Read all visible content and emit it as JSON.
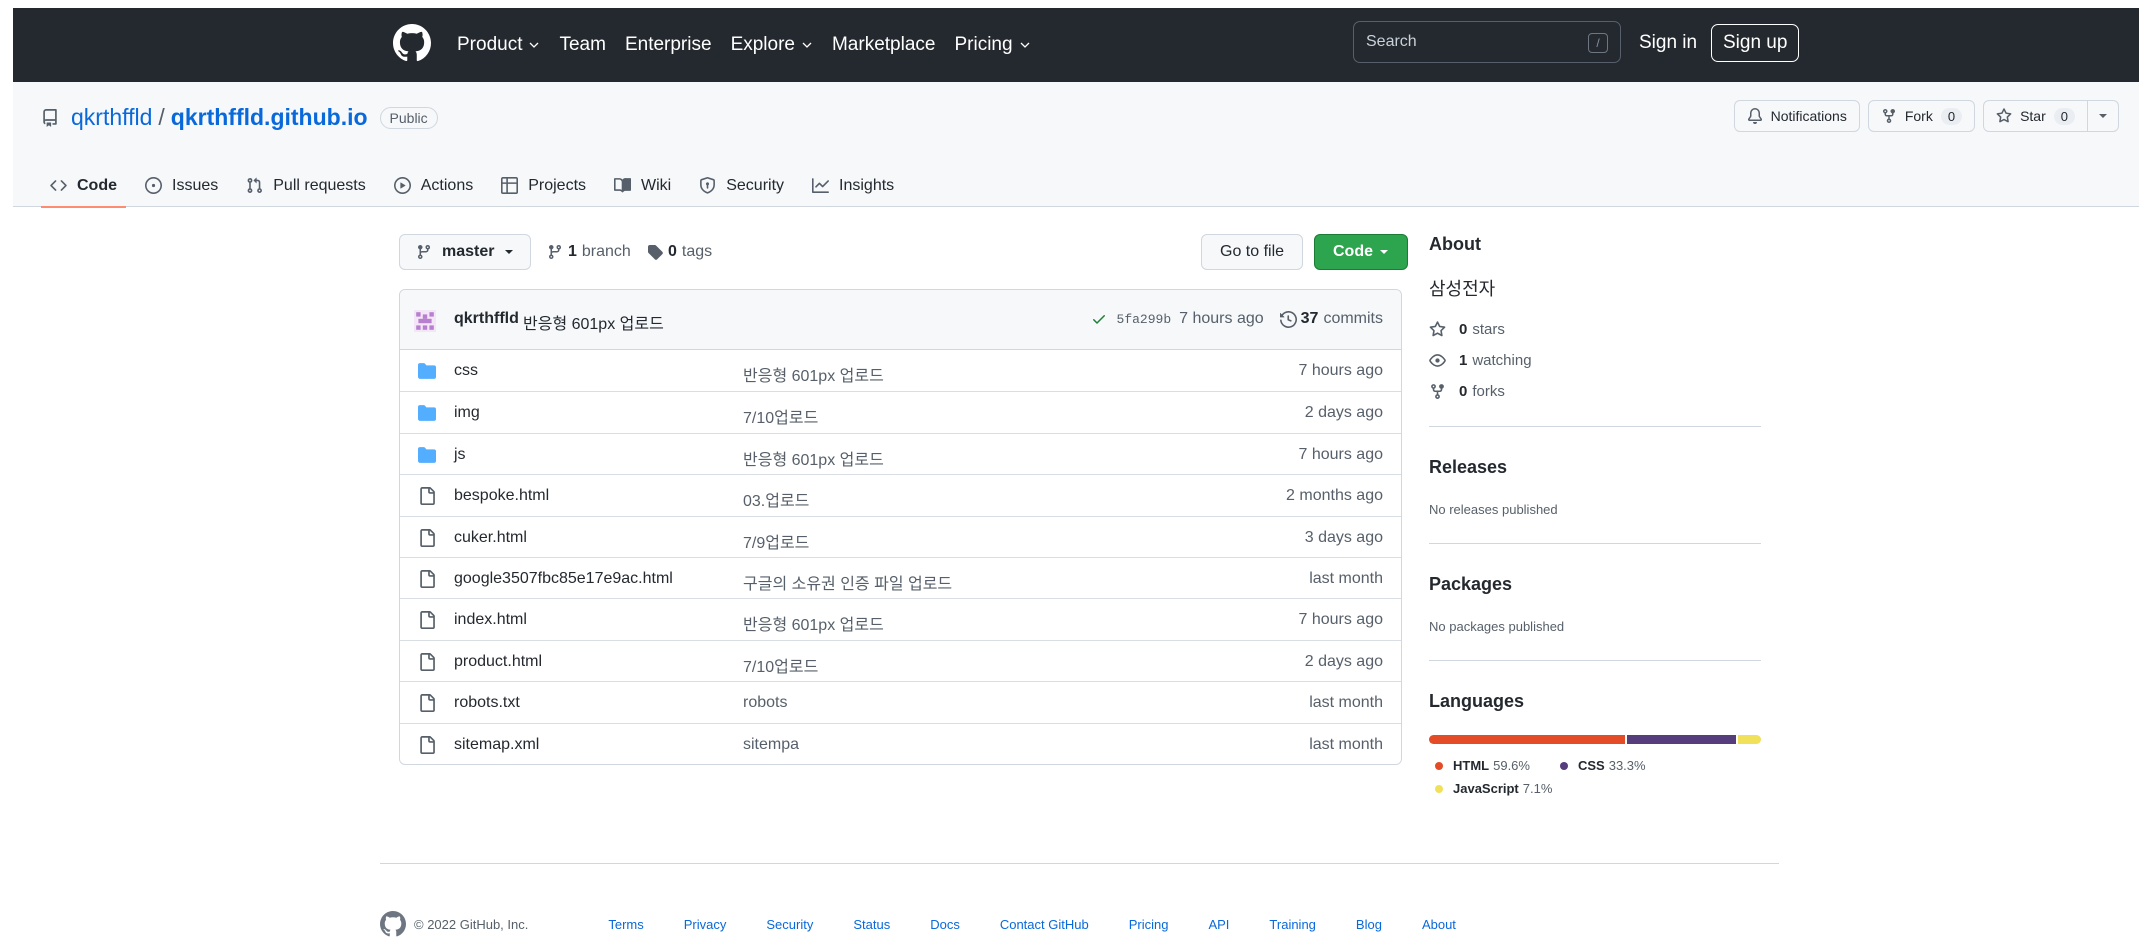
{
  "header": {
    "nav": [
      {
        "label": "Product",
        "dropdown": true
      },
      {
        "label": "Team",
        "dropdown": false
      },
      {
        "label": "Enterprise",
        "dropdown": false
      },
      {
        "label": "Explore",
        "dropdown": true
      },
      {
        "label": "Marketplace",
        "dropdown": false
      },
      {
        "label": "Pricing",
        "dropdown": true
      }
    ],
    "search_placeholder": "Search",
    "search_key": "/",
    "sign_in": "Sign in",
    "sign_up": "Sign up"
  },
  "repo": {
    "owner": "qkrthffld",
    "separator": "/",
    "name": "qkrthffld.github.io",
    "visibility": "Public",
    "notifications_label": "Notifications",
    "fork_label": "Fork",
    "fork_count": "0",
    "star_label": "Star",
    "star_count": "0"
  },
  "tabs": [
    {
      "label": "Code",
      "icon": "code-icon",
      "active": true
    },
    {
      "label": "Issues",
      "icon": "issue-icon",
      "active": false
    },
    {
      "label": "Pull requests",
      "icon": "pull-request-icon",
      "active": false
    },
    {
      "label": "Actions",
      "icon": "play-icon",
      "active": false
    },
    {
      "label": "Projects",
      "icon": "table-icon",
      "active": false
    },
    {
      "label": "Wiki",
      "icon": "book-icon",
      "active": false
    },
    {
      "label": "Security",
      "icon": "shield-icon",
      "active": false
    },
    {
      "label": "Insights",
      "icon": "graph-icon",
      "active": false
    }
  ],
  "toolbar": {
    "branch": "master",
    "branch_count": "1",
    "branch_label": "branch",
    "tag_count": "0",
    "tag_label": "tags",
    "go_to_file": "Go to file",
    "code_button": "Code"
  },
  "latest_commit": {
    "author": "qkrthffld",
    "message": "반응형 601px 업로드",
    "sha": "5fa299b",
    "time": "7 hours ago",
    "commit_count": "37",
    "commit_label": "commits"
  },
  "files": [
    {
      "type": "dir",
      "name": "css",
      "commit": "반응형 601px 업로드",
      "age": "7 hours ago"
    },
    {
      "type": "dir",
      "name": "img",
      "commit": "7/10업로드",
      "age": "2 days ago"
    },
    {
      "type": "dir",
      "name": "js",
      "commit": "반응형 601px 업로드",
      "age": "7 hours ago"
    },
    {
      "type": "file",
      "name": "bespoke.html",
      "commit": "03.업로드",
      "age": "2 months ago"
    },
    {
      "type": "file",
      "name": "cuker.html",
      "commit": "7/9업로드",
      "age": "3 days ago"
    },
    {
      "type": "file",
      "name": "google3507fbc85e17e9ac.html",
      "commit": "구글의 소유권 인증 파일 업로드",
      "age": "last month"
    },
    {
      "type": "file",
      "name": "index.html",
      "commit": "반응형 601px 업로드",
      "age": "7 hours ago"
    },
    {
      "type": "file",
      "name": "product.html",
      "commit": "7/10업로드",
      "age": "2 days ago"
    },
    {
      "type": "file",
      "name": "robots.txt",
      "commit": "robots",
      "age": "last month"
    },
    {
      "type": "file",
      "name": "sitemap.xml",
      "commit": "sitempa",
      "age": "last month"
    }
  ],
  "about": {
    "heading": "About",
    "description": "삼성전자",
    "stars_count": "0",
    "stars_label": "stars",
    "watching_count": "1",
    "watching_label": "watching",
    "forks_count": "0",
    "forks_label": "forks"
  },
  "releases": {
    "heading": "Releases",
    "note": "No releases published"
  },
  "packages": {
    "heading": "Packages",
    "note": "No packages published"
  },
  "languages": {
    "heading": "Languages",
    "items": [
      {
        "name": "HTML",
        "percent": "59.6%",
        "value": 59.6,
        "color": "#e34c26"
      },
      {
        "name": "CSS",
        "percent": "33.3%",
        "value": 33.3,
        "color": "#563d7c"
      },
      {
        "name": "JavaScript",
        "percent": "7.1%",
        "value": 7.1,
        "color": "#f1e05a"
      }
    ]
  },
  "footer": {
    "copyright": "© 2022 GitHub, Inc.",
    "links": [
      "Terms",
      "Privacy",
      "Security",
      "Status",
      "Docs",
      "Contact GitHub",
      "Pricing",
      "API",
      "Training",
      "Blog",
      "About"
    ]
  },
  "colors": {
    "header_bg": "#24292f",
    "link": "#0969da",
    "code_button": "#2da44e",
    "active_tab_underline": "#fd8c73",
    "folder": "#54aeff"
  }
}
